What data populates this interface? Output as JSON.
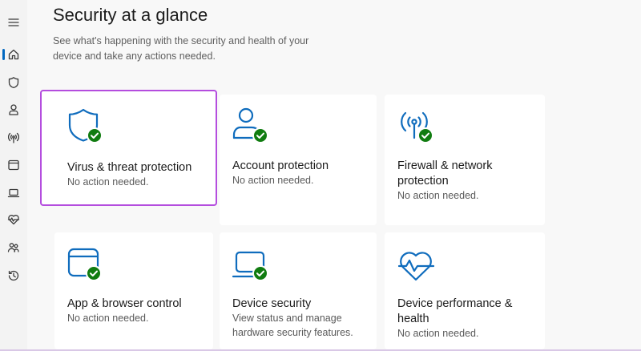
{
  "page": {
    "title": "Security at a glance",
    "subtitle": "See what's happening with the security and health of your device and take any actions needed."
  },
  "sidebar": {
    "items": [
      {
        "icon": "menu-icon"
      },
      {
        "icon": "home-icon",
        "active": true
      },
      {
        "icon": "shield-icon"
      },
      {
        "icon": "person-icon"
      },
      {
        "icon": "network-icon"
      },
      {
        "icon": "app-browser-icon"
      },
      {
        "icon": "device-security-icon"
      },
      {
        "icon": "heart-pulse-icon"
      },
      {
        "icon": "family-icon"
      },
      {
        "icon": "history-icon"
      }
    ]
  },
  "tiles": [
    {
      "title": "Virus & threat protection",
      "status": "No action needed.",
      "icon": "shield-check-icon",
      "selected": true
    },
    {
      "title": "Account protection",
      "status": "No action needed.",
      "icon": "account-check-icon"
    },
    {
      "title": "Firewall & network protection",
      "status": "No action needed.",
      "icon": "antenna-check-icon"
    },
    {
      "title": "App & browser control",
      "status": "No action needed.",
      "icon": "app-window-check-icon"
    },
    {
      "title": "Device security",
      "status": "View status and manage hardware security features.",
      "icon": "laptop-check-icon"
    },
    {
      "title": "Device performance & health",
      "status": "No action needed.",
      "icon": "heart-pulse-icon"
    }
  ],
  "colors": {
    "accent": "#0067c0",
    "icon_blue": "#0f6cbd",
    "check_green": "#107c10",
    "selection": "#b44dde"
  }
}
